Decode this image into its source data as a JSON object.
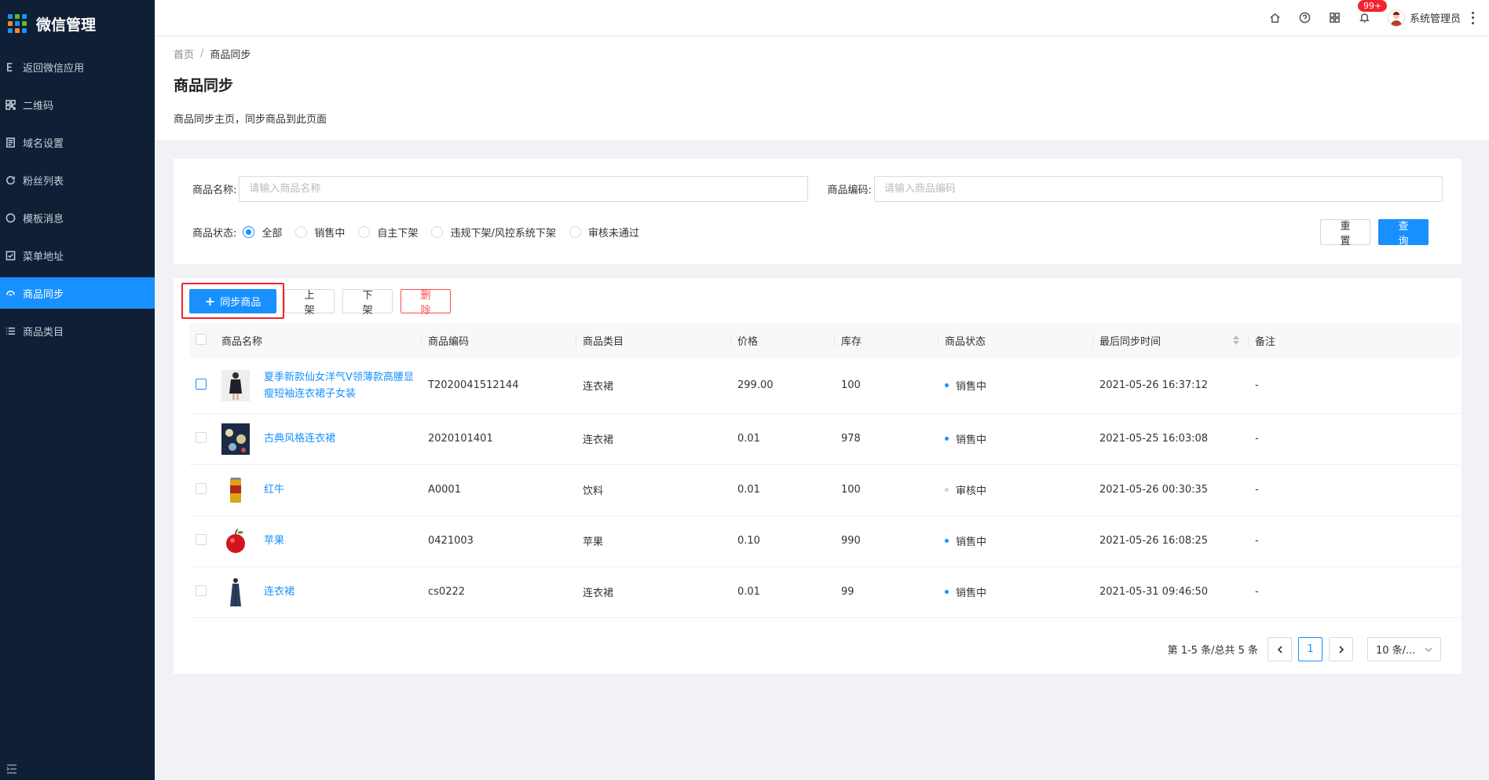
{
  "app": {
    "title": "微信管理"
  },
  "sidebar": {
    "items": [
      {
        "label": "返回微信应用",
        "icon": "back-icon"
      },
      {
        "label": "二维码",
        "icon": "qrcode-icon"
      },
      {
        "label": "域名设置",
        "icon": "domain-icon"
      },
      {
        "label": "粉丝列表",
        "icon": "refresh-icon"
      },
      {
        "label": "模板消息",
        "icon": "message-icon"
      },
      {
        "label": "菜单地址",
        "icon": "menu-check-icon"
      },
      {
        "label": "商品同步",
        "icon": "sync-icon",
        "active": true
      },
      {
        "label": "商品类目",
        "icon": "list-icon"
      }
    ]
  },
  "header": {
    "notification_badge": "99+",
    "user_name": "系统管理员"
  },
  "breadcrumb": {
    "home": "首页",
    "separator": "/",
    "current": "商品同步"
  },
  "page": {
    "title": "商品同步",
    "description": "商品同步主页，同步商品到此页面"
  },
  "search": {
    "name_label": "商品名称:",
    "name_placeholder": "请输入商品名称",
    "code_label": "商品编码:",
    "code_placeholder": "请输入商品编码",
    "status_label": "商品状态:",
    "status_options": [
      "全部",
      "销售中",
      "自主下架",
      "违规下架/风控系统下架",
      "审核未通过"
    ],
    "selected_status": "全部",
    "reset_label": "重 置",
    "query_label": "查 询"
  },
  "toolbar": {
    "sync_label": "同步商品",
    "on_shelf_label": "上 架",
    "off_shelf_label": "下 架",
    "delete_label": "删 除"
  },
  "table": {
    "columns": [
      "商品名称",
      "商品编码",
      "商品类目",
      "价格",
      "库存",
      "商品状态",
      "最后同步时间",
      "备注"
    ],
    "rows": [
      {
        "name": "夏季新款仙女洋气V领薄款高腰显瘦短袖连衣裙子女装",
        "code": "T2020041512144",
        "category": "连衣裙",
        "price": "299.00",
        "stock": "100",
        "status": "销售中",
        "status_color": "#1890ff",
        "sync_time": "2021-05-26 16:37:12",
        "remark": "-",
        "thumb": "dress-black-thumb"
      },
      {
        "name": "古典风格连衣裙",
        "code": "2020101401",
        "category": "连衣裙",
        "price": "0.01",
        "stock": "978",
        "status": "销售中",
        "status_color": "#1890ff",
        "sync_time": "2021-05-25 16:03:08",
        "remark": "-",
        "thumb": "floral-dress-thumb"
      },
      {
        "name": "红牛",
        "code": "A0001",
        "category": "饮料",
        "price": "0.01",
        "stock": "100",
        "status": "审核中",
        "status_color": "#d0d0d0",
        "sync_time": "2021-05-26 00:30:35",
        "remark": "-",
        "thumb": "can-thumb"
      },
      {
        "name": "苹果",
        "code": "0421003",
        "category": "苹果",
        "price": "0.10",
        "stock": "990",
        "status": "销售中",
        "status_color": "#1890ff",
        "sync_time": "2021-05-26 16:08:25",
        "remark": "-",
        "thumb": "apple-thumb"
      },
      {
        "name": "连衣裙",
        "code": "cs0222",
        "category": "连衣裙",
        "price": "0.01",
        "stock": "99",
        "status": "销售中",
        "status_color": "#1890ff",
        "sync_time": "2021-05-31 09:46:50",
        "remark": "-",
        "thumb": "long-dress-thumb"
      }
    ]
  },
  "pagination": {
    "total_text": "第 1-5 条/总共 5 条",
    "current_page": "1",
    "page_size": "10 条/..."
  },
  "colors": {
    "primary": "#1890ff",
    "sidebar_bg": "#0f1f35",
    "danger": "#f5222d"
  }
}
